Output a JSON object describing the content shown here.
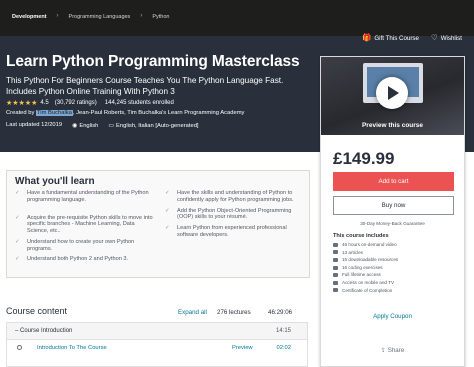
{
  "breadcrumb": {
    "items": [
      "Development",
      "Programming Languages",
      "Python"
    ],
    "separator": "›"
  },
  "actions": {
    "gift": "Gift This Course",
    "wishlist": "Wishlist"
  },
  "course": {
    "title": "Learn Python Programming Masterclass",
    "subtitle": "This Python For Beginners Course Teaches You The Python Language Fast. Includes Python Online Training With Python 3",
    "stars": "★★★★★",
    "rating_value": "4.5",
    "rating_count": "(30,792 ratings)",
    "students": "144,245 students enrolled",
    "created_prefix": "Created by",
    "created_highlight": "Tim Buchalka",
    "created_rest": ", Jean-Paul Roberts, Tim Buchalka's Learn Programming Academy",
    "last_updated": "Last updated 12/2019",
    "language": "English",
    "captions": "English, Italian [Auto-generated]"
  },
  "sidebar": {
    "preview_label": "Preview this course",
    "price": "£149.99",
    "add_to_cart": "Add to cart",
    "buy_now": "Buy now",
    "guarantee": "30-Day Money-Back Guarantee",
    "includes_heading": "This course includes",
    "includes": [
      "46 hours on-demand video",
      "13 articles",
      "15 downloadable resources",
      "16 coding exercises",
      "Full lifetime access",
      "Access on mobile and TV",
      "Certificate of Completion"
    ],
    "apply_coupon": "Apply Coupon",
    "share": "Share"
  },
  "learn": {
    "heading": "What you'll learn",
    "left": [
      "Have a fundamental understanding of the Python programming language.",
      "Acquire the pre-requisite Python skills to move into specific branches - Machine Learning, Data Science, etc..",
      "Understand how to create your own Python programs.",
      "Understand both Python 2 and Python 3."
    ],
    "right": [
      "Have the skills and understanding of Python to confidently apply for Python programming jobs.",
      "Add the Python Object-Oriented Programming (OOP) skills to your résumé.",
      "Learn Python from experienced professional software developers."
    ]
  },
  "content": {
    "heading": "Course content",
    "expand_all": "Expand all",
    "lectures": "276 lectures",
    "total_time": "46:29:06",
    "section_title": "Course Introduction",
    "section_time": "14:15",
    "lecture_title": "Introduction To The Course",
    "lecture_preview": "Preview",
    "lecture_time": "02:02"
  },
  "colors": {
    "hero_bg": "#29303b",
    "cart": "#ec5252",
    "link": "#007791",
    "stars": "#f4c150"
  }
}
